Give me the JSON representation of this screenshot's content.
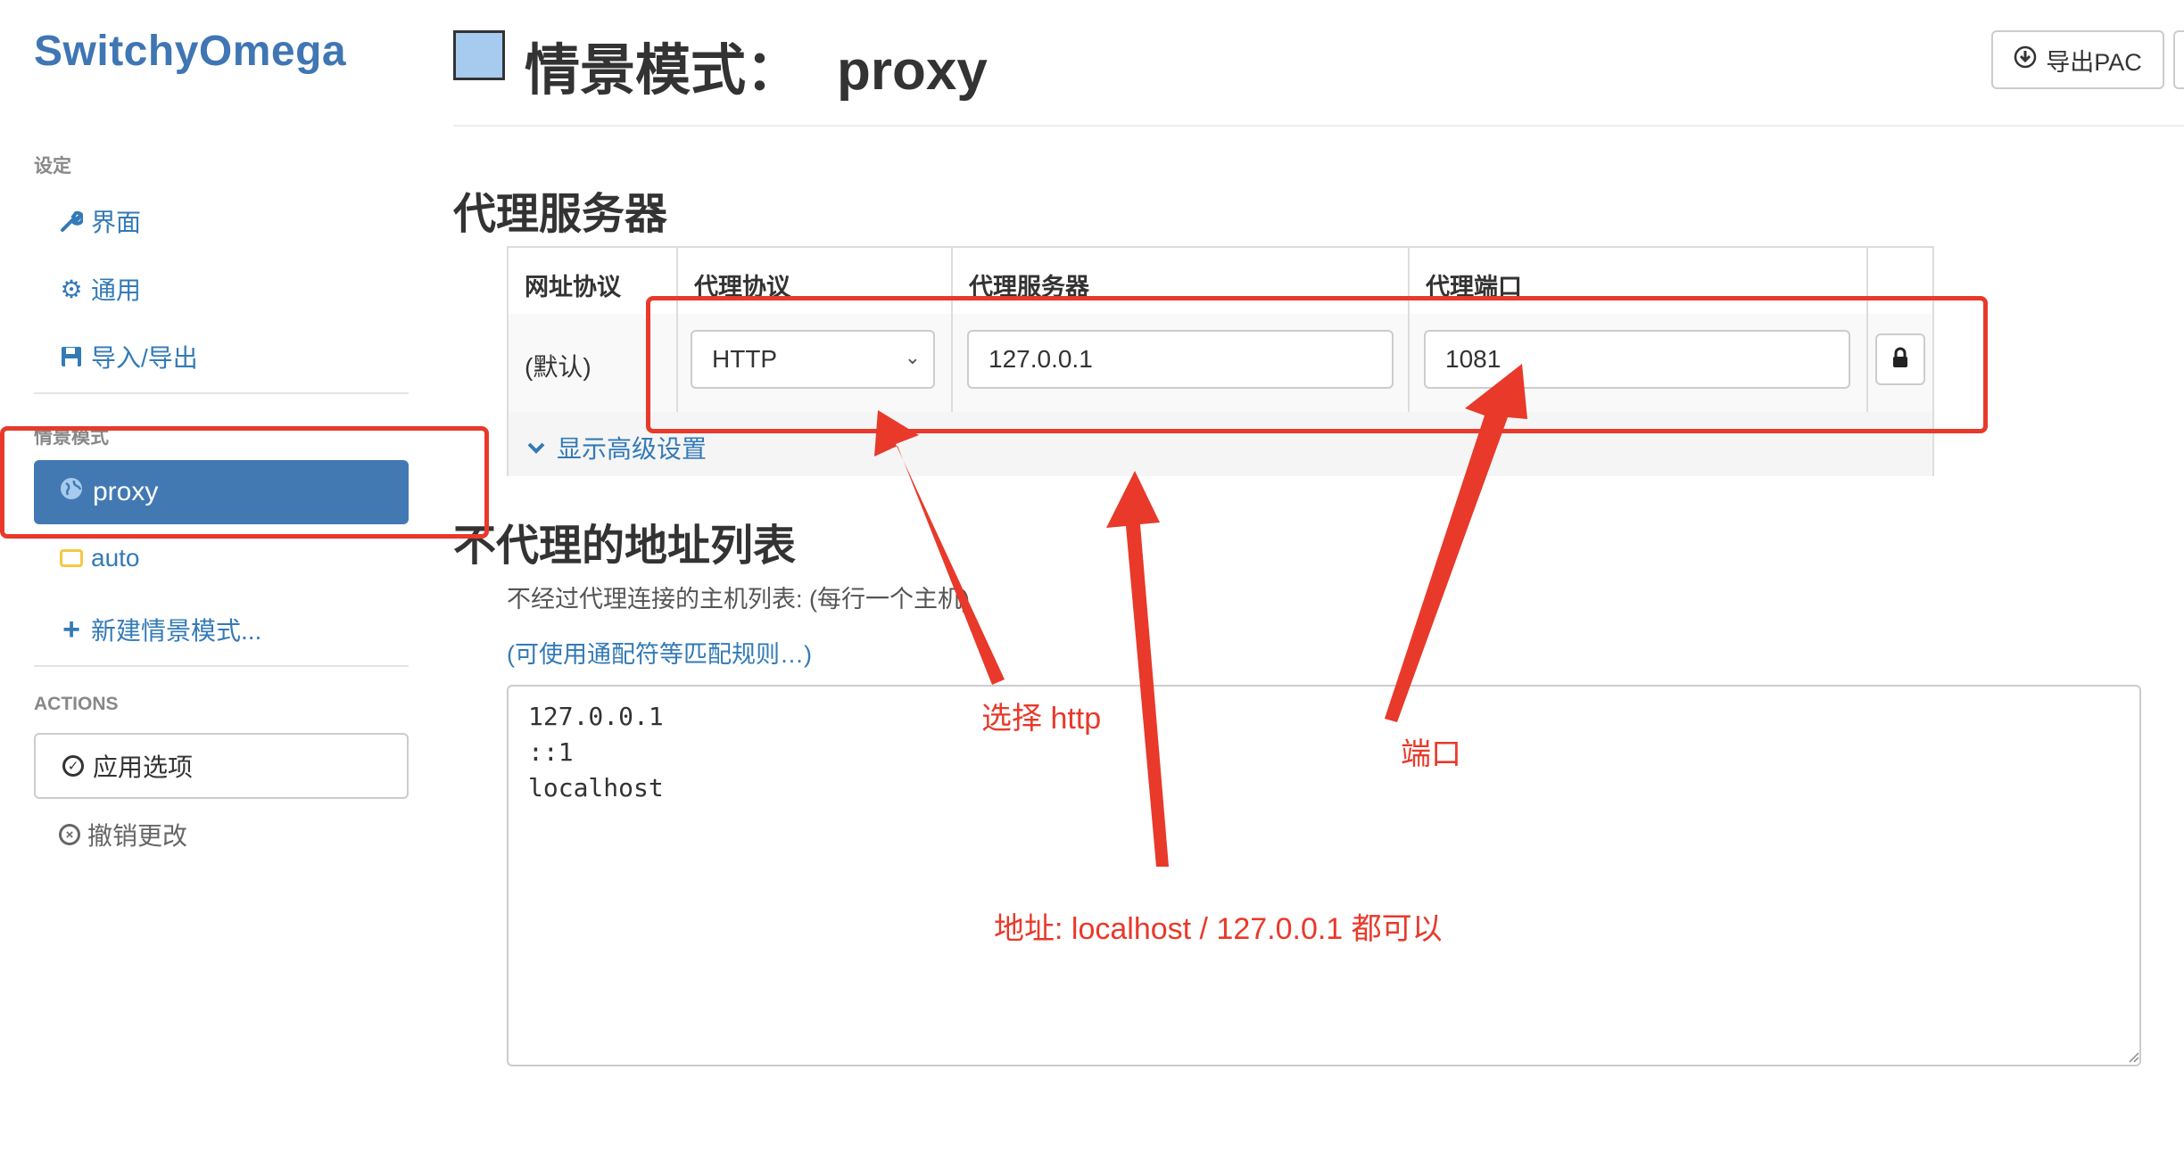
{
  "app": {
    "brand": "SwitchyOmega"
  },
  "sidebar": {
    "settings_header": "设定",
    "settings_items": [
      {
        "label": "界面",
        "icon": "wrench-icon"
      },
      {
        "label": "通用",
        "icon": "gear-icon"
      },
      {
        "label": "导入/导出",
        "icon": "floppy-icon"
      }
    ],
    "profiles_header": "情景模式",
    "profiles": [
      {
        "label": "proxy",
        "icon": "globe-icon",
        "active": true
      },
      {
        "label": "auto",
        "icon": "auto-switch-icon",
        "active": false
      }
    ],
    "new_profile": "新建情景模式...",
    "actions_header": "ACTIONS",
    "apply": "应用选项",
    "discard": "撤销更改"
  },
  "header": {
    "title_prefix": "情景模式：",
    "profile_name": "proxy",
    "profile_color": "#a6cbef",
    "export_label": "导出PAC"
  },
  "proxy_section": {
    "title": "代理服务器",
    "columns": [
      "网址协议",
      "代理协议",
      "代理服务器",
      "代理端口"
    ],
    "row": {
      "scheme": "(默认)",
      "protocol": "HTTP",
      "server": "127.0.0.1",
      "port": "1081"
    },
    "advanced_toggle": "显示高级设置"
  },
  "bypass_section": {
    "title": "不代理的地址列表",
    "help": "不经过代理连接的主机列表: (每行一个主机)",
    "help_link": "(可使用通配符等匹配规则…)",
    "list": "127.0.0.1\n::1\nlocalhost"
  },
  "annotations": {
    "color": "#e8392a",
    "select_http": "选择 http",
    "port": "端口",
    "address": "地址: localhost / 127.0.0.1 都可以"
  }
}
